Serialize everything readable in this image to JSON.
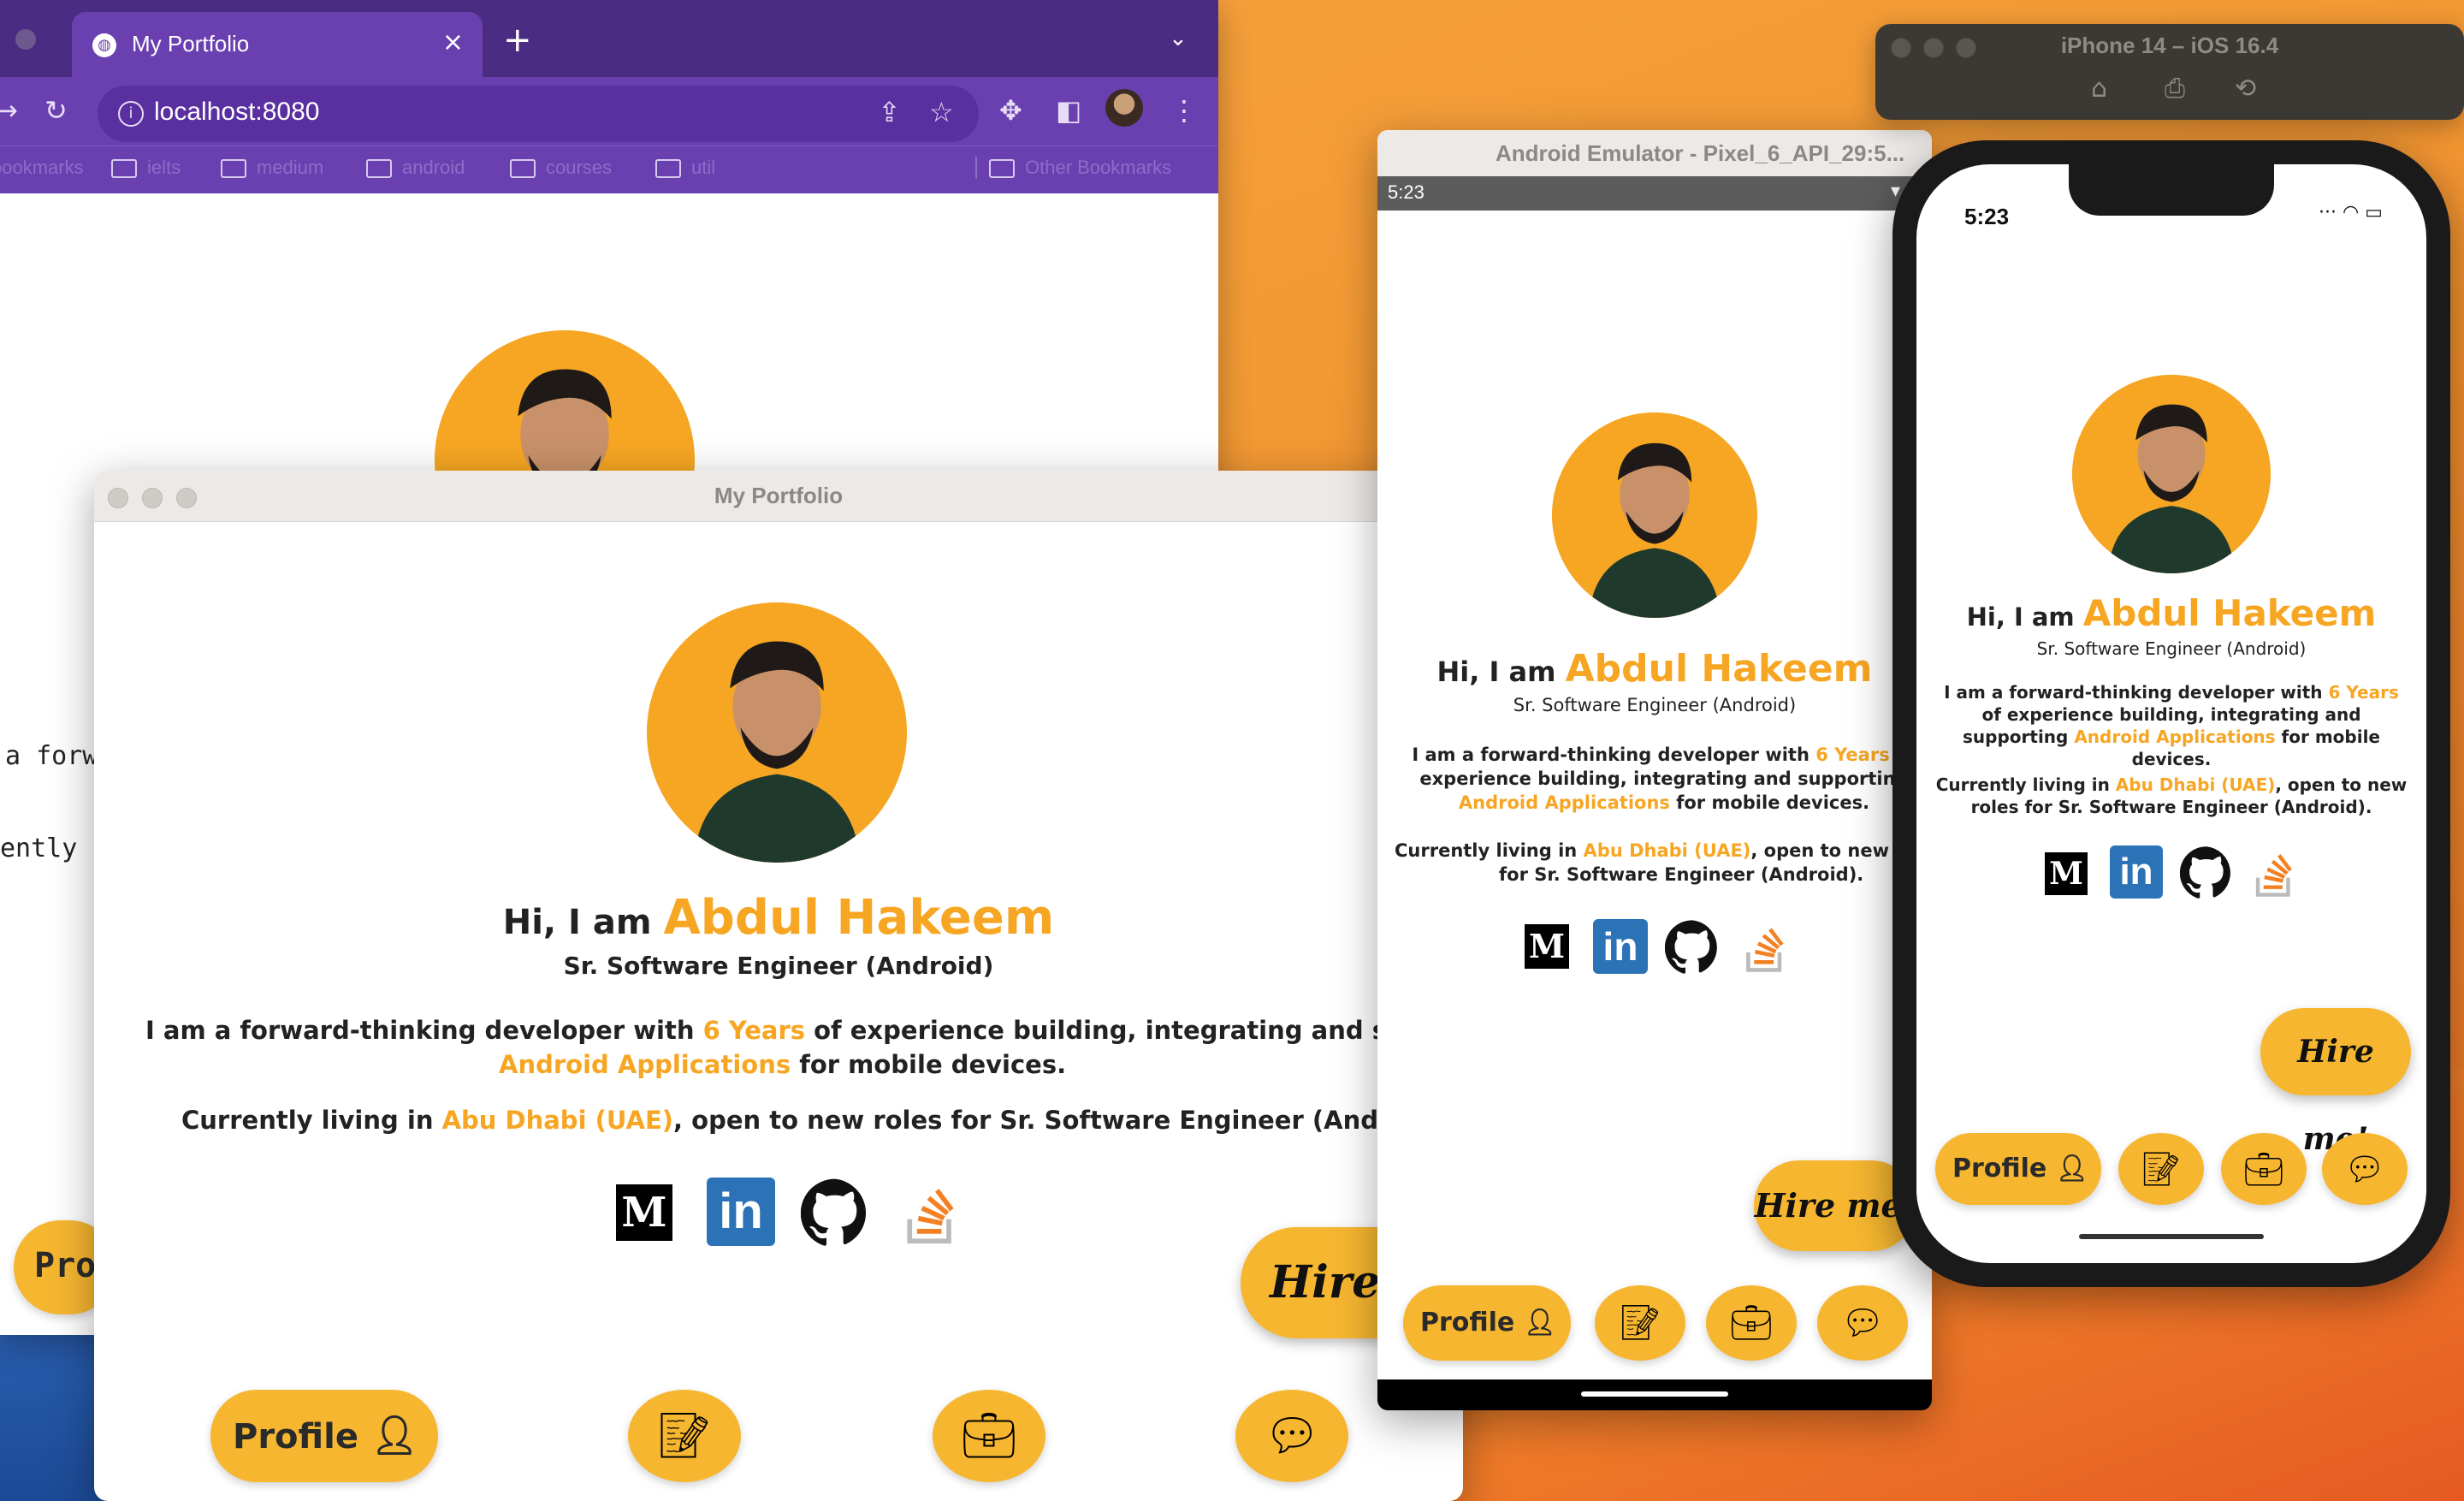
{
  "chrome": {
    "tab_title": "My Portfolio",
    "url": "localhost:8080",
    "bookmarks": [
      "bookmarks",
      "ielts",
      "medium",
      "android",
      "courses",
      "util",
      "Other Bookmarks"
    ],
    "partial_text_1": "a forw",
    "partial_text_2": "ently",
    "partial_button": "Pro"
  },
  "desktop": {
    "window_title": "My Portfolio"
  },
  "android": {
    "window_title": "Android Emulator - Pixel_6_API_29:5...",
    "status_time": "5:23"
  },
  "ios": {
    "sim_title": "iPhone 14 – iOS 16.4",
    "status_time": "5:23"
  },
  "profile": {
    "greeting": "Hi, I am",
    "name": "Abdul Hakeem",
    "role": "Sr. Software Engineer (Android)",
    "intro_pre": "I am a forward-thinking developer with",
    "years": "6 Years",
    "intro_mid": "of experience building, integrating and supporting",
    "apps": "Android Applications",
    "intro_post": "for mobile devices.",
    "intro_mid_cut": "of experience building, integrating and supporti",
    "living_pre": "Currently living in",
    "location": "Abu Dhabi (UAE)",
    "living_post": ", open to new roles for Sr. Software Engineer (Android).",
    "living_post_cut": ", open to new rol",
    "living_line2": "for Sr. Software Engineer (Android).",
    "living_ios_post": ", open to new",
    "living_ios_line2": "roles for Sr. Software Engineer (Android).",
    "socials": [
      "medium-icon",
      "linkedin-icon",
      "github-icon",
      "stackoverflow-icon"
    ],
    "hire_label": "Hire me!",
    "hire_label_cut": "Hire me",
    "nav": {
      "profile_label": "Profile"
    }
  },
  "colors": {
    "accent": "#f6a623",
    "button": "#f6b630",
    "chrome_purple": "#6a3fb0"
  }
}
